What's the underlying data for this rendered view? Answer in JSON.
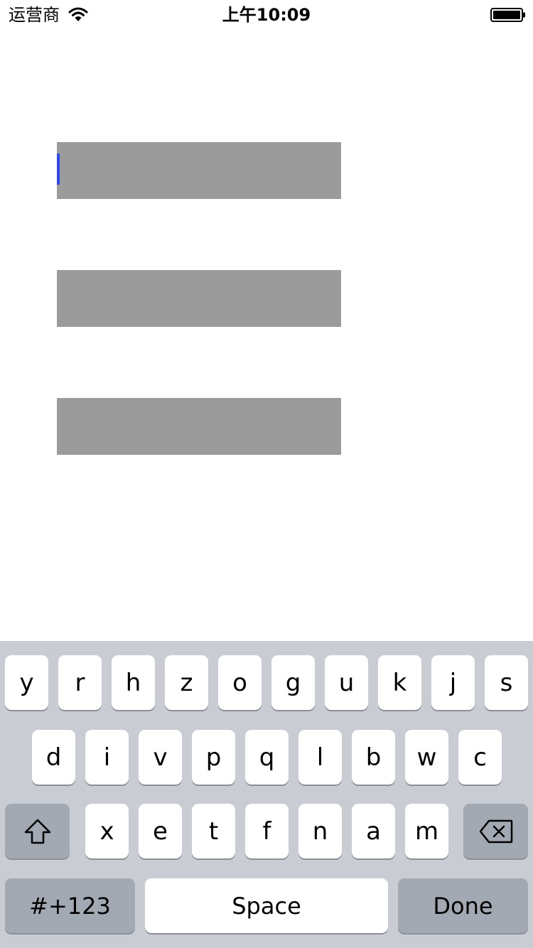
{
  "status_bar": {
    "carrier": "运营商",
    "time": "上午10:09",
    "wifi_icon": "wifi-icon",
    "battery_icon": "battery-full-icon"
  },
  "form": {
    "fields": [
      {
        "value": "",
        "focused": true
      },
      {
        "value": "",
        "focused": false
      },
      {
        "value": "",
        "focused": false
      }
    ],
    "field_color": "#9b9b9b",
    "cursor_color": "#3048f2"
  },
  "keyboard": {
    "row1": [
      "y",
      "r",
      "h",
      "z",
      "o",
      "g",
      "u",
      "k",
      "j",
      "s"
    ],
    "row2": [
      "d",
      "i",
      "v",
      "p",
      "q",
      "l",
      "b",
      "w",
      "c"
    ],
    "row3": [
      "x",
      "e",
      "t",
      "f",
      "n",
      "a",
      "m"
    ],
    "shift_icon": "shift-arrow-icon",
    "delete_icon": "backspace-icon",
    "mode_label": "#+123",
    "space_label": "Space",
    "done_label": "Done",
    "background_color": "#c9ccd3",
    "key_color": "#ffffff",
    "function_key_color": "#a3a9b3"
  }
}
